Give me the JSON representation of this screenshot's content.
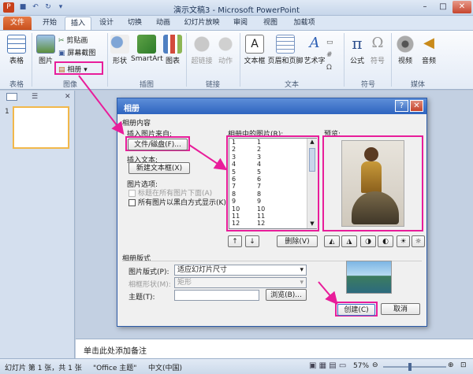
{
  "app": {
    "title": "演示文稿3 - Microsoft PowerPoint",
    "window_controls": [
      "minimize-icon",
      "maximize-icon",
      "close-icon"
    ]
  },
  "tabs": [
    {
      "label": "文件"
    },
    {
      "label": "开始"
    },
    {
      "label": "插入"
    },
    {
      "label": "设计"
    },
    {
      "label": "切换"
    },
    {
      "label": "动画"
    },
    {
      "label": "幻灯片放映"
    },
    {
      "label": "审阅"
    },
    {
      "label": "视图"
    },
    {
      "label": "加载项"
    }
  ],
  "ribbon": {
    "table": {
      "label": "表格",
      "group": "表格"
    },
    "image_group": {
      "picture": "图片",
      "clipart": "剪贴画",
      "screenshot": "屏幕截图",
      "album": "相册",
      "group": "图像"
    },
    "illust_group": {
      "shapes": "形状",
      "smartart": "SmartArt",
      "chart": "图表",
      "group": "插图"
    },
    "link_group": {
      "hyperlink": "超链接",
      "action": "动作",
      "group": "链接"
    },
    "text_group": {
      "textbox": "文本框",
      "header": "页眉和页脚",
      "wordart": "艺术字",
      "group": "文本"
    },
    "symbol_group": {
      "equation": "公式",
      "symbol": "符号",
      "group": "符号"
    },
    "media_group": {
      "video": "视频",
      "audio": "音频",
      "group": "媒体"
    }
  },
  "slide_thumb_number": "1",
  "notes_placeholder": "单击此处添加备注",
  "status": {
    "slide": "幻灯片 第 1 张，共 1 张",
    "theme": "\"Office 主题\"",
    "language": "中文(中国)",
    "zoom": "57%"
  },
  "dialog": {
    "title": "相册",
    "section_content": "相册内容",
    "insert_from": "插入图片来自:",
    "file_disk_button": "文件/磁盘(F)...",
    "insert_text": "插入文本:",
    "new_textbox_button": "新建文本框(X)",
    "pic_options": "图片选项:",
    "caption_below": "标题在所有图片下面(A)",
    "all_bw": "所有图片以黑白方式显示(K)",
    "pictures_in_album": "相册中的图片(R):",
    "preview": "预览:",
    "list_items": [
      [
        "1",
        "1"
      ],
      [
        "2",
        "2"
      ],
      [
        "3",
        "3"
      ],
      [
        "4",
        "4"
      ],
      [
        "5",
        "5"
      ],
      [
        "6",
        "6"
      ],
      [
        "7",
        "7"
      ],
      [
        "8",
        "8"
      ],
      [
        "9",
        "9"
      ],
      [
        "10",
        "10"
      ],
      [
        "11",
        "11"
      ],
      [
        "12",
        "12"
      ]
    ],
    "delete_button": "删除(V)",
    "section_layout": "相册版式",
    "layout_label": "图片版式(P):",
    "layout_value": "适应幻灯片尺寸",
    "frame_label": "相框形状(M):",
    "frame_value": "矩形",
    "theme_label": "主题(T):",
    "theme_value": "",
    "browse_button": "浏览(B)...",
    "create_button": "创建(C)",
    "cancel_button": "取消",
    "help_icon": "help-icon",
    "close_icon": "close-icon"
  },
  "colors": {
    "highlight": "#e81d9a",
    "dialog_title": "#2e64bf",
    "file_tab": "#c9501d"
  }
}
